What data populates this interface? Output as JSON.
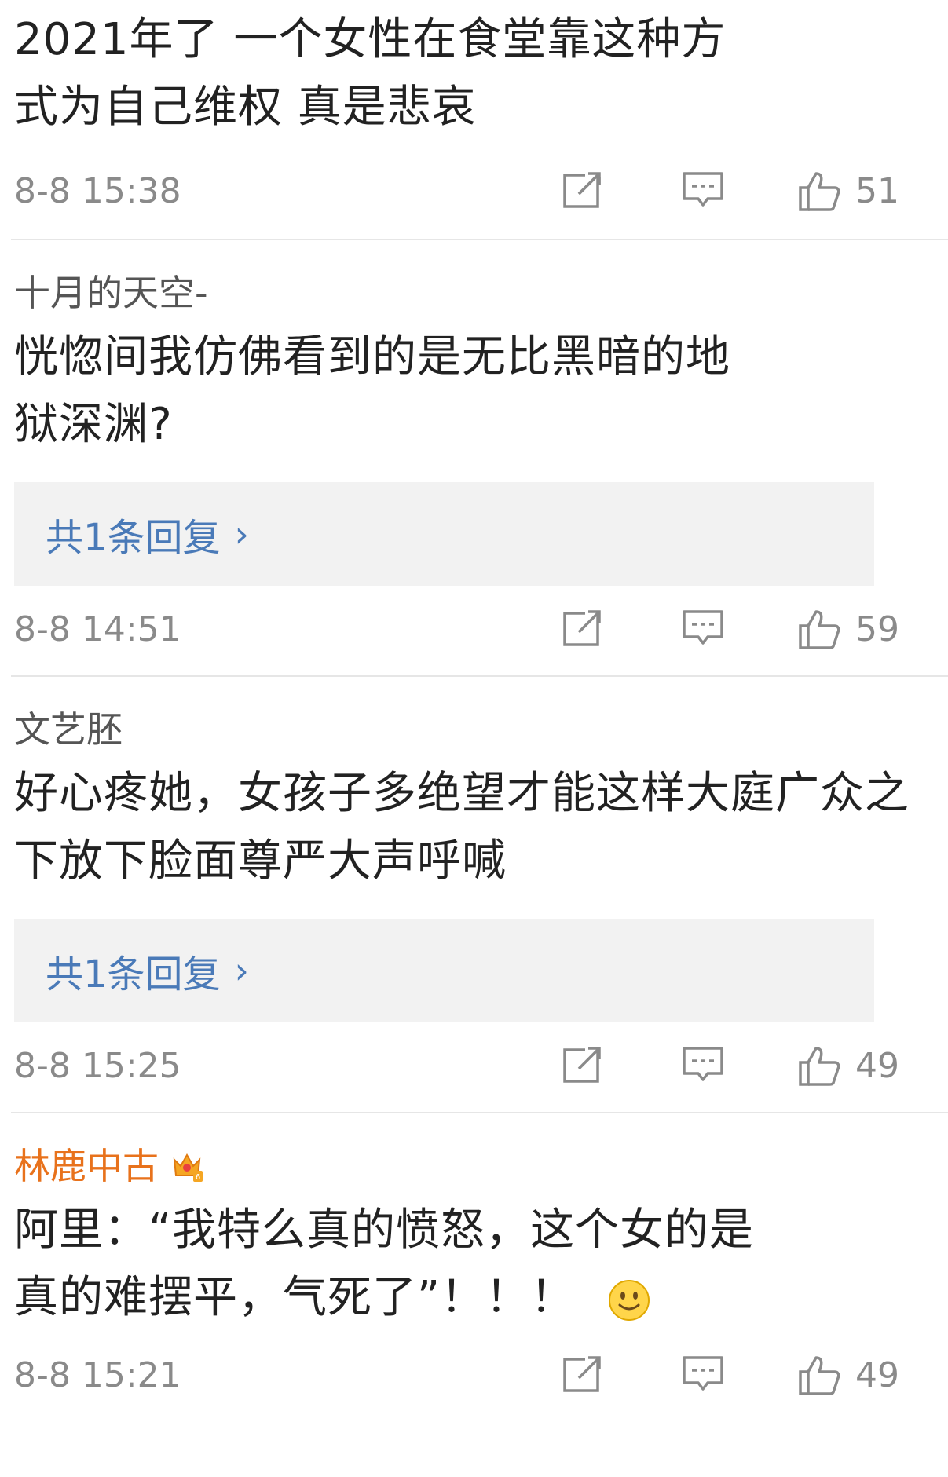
{
  "comments": [
    {
      "author": "",
      "content": "2021年了 一个女性在食堂靠这种方式为自己维权 真是悲哀",
      "time": "8-8 15:38",
      "likes": "51",
      "reply": ""
    },
    {
      "author": "十月的天空-",
      "content": "恍惚间我仿佛看到的是无比黑暗的地狱深渊?",
      "time": "8-8 14:51",
      "likes": "59",
      "reply": "共1条回复"
    },
    {
      "author": "文艺胚",
      "content": "好心疼她，女孩子多绝望才能这样大庭广众之下放下脸面尊严大声呼喊",
      "time": "8-8 15:25",
      "likes": "49",
      "reply": "共1条回复"
    },
    {
      "author": "林鹿中古",
      "content": "阿里：“我特么真的愤怒，这个女的是真的难摆平，气死了”！！！",
      "time": "8-8 15:21",
      "likes": "49",
      "reply": ""
    }
  ],
  "icons": {
    "share": "share-icon",
    "comment": "comment-icon",
    "like": "thumbs-up-icon",
    "vip": "crown-badge-icon",
    "emoji": "smile-emoji-icon"
  },
  "colors": {
    "vip_name": "#e8721c",
    "reply_link": "#4a7ab8",
    "meta_gray": "#8a8a8a"
  }
}
